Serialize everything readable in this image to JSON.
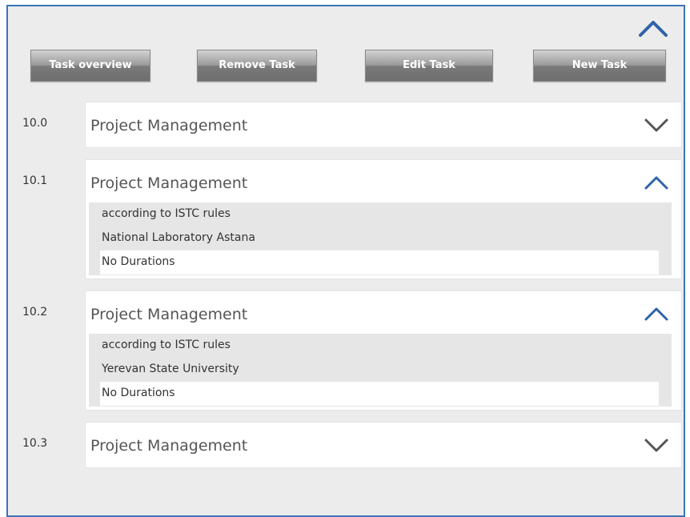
{
  "toolbar": {
    "task_overview_label": "Task overview",
    "remove_task_label": "Remove Task",
    "edit_task_label": "Edit Task",
    "new_task_label": "New Task"
  },
  "tasks": [
    {
      "number": "10.0",
      "title": "Project Management",
      "expanded": false,
      "toggle_icon": "chevron-down-icon"
    },
    {
      "number": "10.1",
      "title": "Project Management",
      "expanded": true,
      "toggle_icon": "chevron-up-icon",
      "details": {
        "rules": "according to ISTC rules",
        "organization": "National Laboratory Astana",
        "durations": "No Durations"
      }
    },
    {
      "number": "10.2",
      "title": "Project Management",
      "expanded": true,
      "toggle_icon": "chevron-up-icon",
      "details": {
        "rules": "according to ISTC rules",
        "organization": "Yerevan State University",
        "durations": "No Durations"
      }
    },
    {
      "number": "10.3",
      "title": "Project Management",
      "expanded": false,
      "toggle_icon": "chevron-down-icon"
    }
  ],
  "colors": {
    "panel_border": "#3a74b8",
    "chevron_up": "#2e62a8",
    "chevron_down": "#555555",
    "panel_background": "#ececec"
  }
}
